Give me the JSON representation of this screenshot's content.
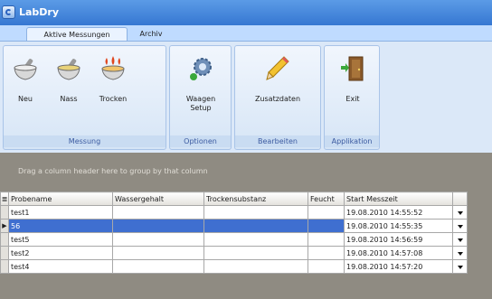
{
  "app": {
    "title": "LabDry"
  },
  "tabs": [
    {
      "label": "Aktive Messungen",
      "active": true
    },
    {
      "label": "Archiv",
      "active": false
    }
  ],
  "ribbon": {
    "groups": [
      {
        "caption": "Messung",
        "buttons": [
          {
            "label": "Neu",
            "icon": "mortar-pestle-icon"
          },
          {
            "label": "Nass",
            "icon": "wet-mortar-icon"
          },
          {
            "label": "Trocken",
            "icon": "heated-mortar-icon"
          }
        ]
      },
      {
        "caption": "Optionen",
        "buttons": [
          {
            "label": "Waagen Setup",
            "icon": "gear-icon"
          }
        ]
      },
      {
        "caption": "Bearbeiten",
        "buttons": [
          {
            "label": "Zusatzdaten",
            "icon": "pencil-icon"
          }
        ]
      },
      {
        "caption": "Applikation",
        "buttons": [
          {
            "label": "Exit",
            "icon": "exit-door-icon"
          }
        ]
      }
    ]
  },
  "grid": {
    "group_hint": "Drag a column header here to group by that column",
    "columns": [
      "Probename",
      "Wassergehalt",
      "Trockensubstanz",
      "Feucht",
      "Start Messzeit"
    ],
    "rows": [
      {
        "probename": "test1",
        "start": "19.08.2010 14:55:52",
        "selected": false
      },
      {
        "probename": "56",
        "start": "19.08.2010 14:55:35",
        "selected": true
      },
      {
        "probename": "test5",
        "start": "19.08.2010 14:56:59",
        "selected": false
      },
      {
        "probename": "test2",
        "start": "19.08.2010 14:57:08",
        "selected": false
      },
      {
        "probename": "test4",
        "start": "19.08.2010 14:57:20",
        "selected": false
      }
    ]
  },
  "colors": {
    "titlebar": "#3677d2",
    "ribbon": "#dbe8f8",
    "selection": "#3f6fd0",
    "grid_area": "#8f8b82"
  }
}
